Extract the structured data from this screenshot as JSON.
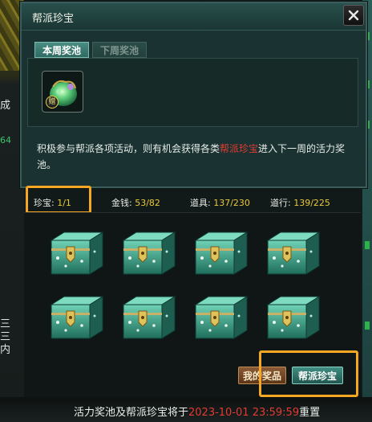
{
  "popup": {
    "title": "帮派珍宝",
    "tabs": [
      {
        "label": "本周奖池",
        "active": true
      },
      {
        "label": "下周奖池",
        "active": false
      }
    ],
    "prize_badge": "赠",
    "description_before": "积极参与帮派各项活动，则有机会获得各类",
    "description_highlight": "帮派珍宝",
    "description_after": "进入下一周的活力奖池。"
  },
  "stats": [
    {
      "label": "珍宝:",
      "value": "1/1"
    },
    {
      "label": "金钱:",
      "value": "53/82"
    },
    {
      "label": "道具:",
      "value": "137/230"
    },
    {
      "label": "道行:",
      "value": "139/225"
    }
  ],
  "buttons": {
    "my_prizes": "我的奖品",
    "guild_treasure": "帮派珍宝"
  },
  "footer": {
    "prefix": "活力奖池及帮派珍宝将于",
    "datetime": "2023-10-01 23:59:59",
    "suffix": "重置"
  },
  "background": {
    "left_fragment_1": "成",
    "left_fragment_2": "64",
    "left_fragment_3": "三",
    "left_fragment_4": "三",
    "left_fragment_5": "内"
  },
  "colors": {
    "highlight_red": "#e33a32",
    "value_yellow": "#e8c93a",
    "annotation_orange": "#f5a623"
  },
  "chest_count": 8
}
